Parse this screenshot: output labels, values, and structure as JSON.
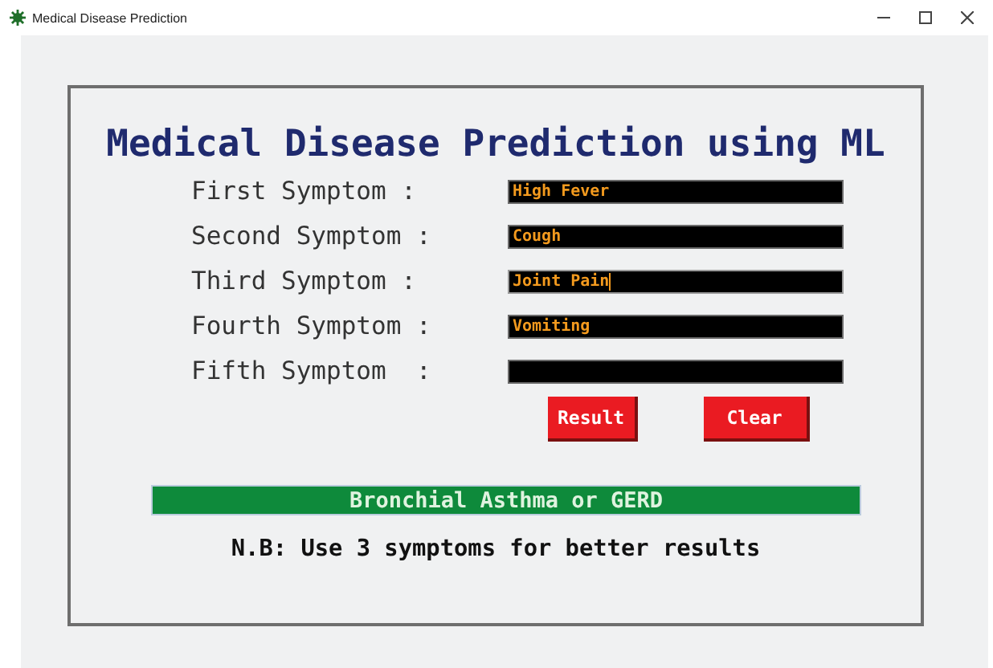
{
  "window": {
    "title": "Medical Disease Prediction"
  },
  "heading": "Medical Disease Prediction using ML",
  "fields": [
    {
      "label": "First Symptom :",
      "value": "High Fever",
      "focused": false
    },
    {
      "label": "Second Symptom :",
      "value": "Cough",
      "focused": false
    },
    {
      "label": "Third Symptom :",
      "value": "Joint Pain",
      "focused": true
    },
    {
      "label": "Fourth Symptom :",
      "value": "Vomiting",
      "focused": false
    },
    {
      "label": "Fifth Symptom  :",
      "focused": false
    }
  ],
  "buttons": [
    "Result",
    "Clear"
  ],
  "result": "Bronchial Asthma or GERD",
  "note": "N.B: Use 3 symptoms for better results"
}
